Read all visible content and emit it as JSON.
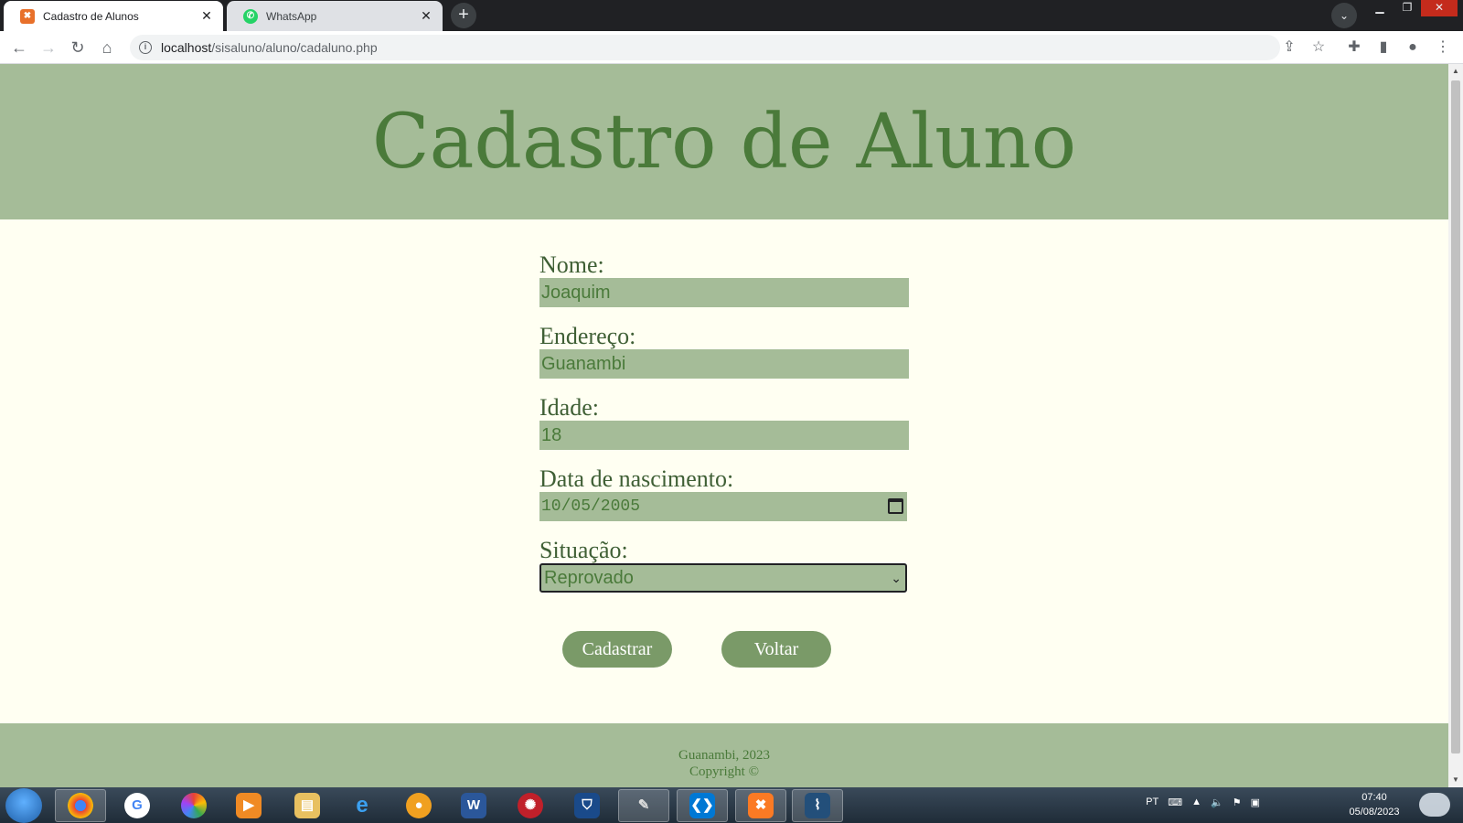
{
  "browser": {
    "tabs": [
      {
        "title": "Cadastro de Alunos",
        "favicon": "xampp-icon",
        "active": true
      },
      {
        "title": "WhatsApp",
        "favicon": "whatsapp-icon",
        "active": false
      }
    ],
    "url_host": "localhost",
    "url_path": "/sisaluno/aluno/cadaluno.php"
  },
  "page": {
    "title": "Cadastro de Aluno",
    "fields": {
      "nome": {
        "label": "Nome:",
        "value": "Joaquim"
      },
      "endereco": {
        "label": "Endereço:",
        "value": "Guanambi"
      },
      "idade": {
        "label": "Idade:",
        "value": "18"
      },
      "data_nascimento": {
        "label": "Data de nascimento:",
        "value": "10/05/2005"
      },
      "situacao": {
        "label": "Situação:",
        "value": "Reprovado"
      }
    },
    "buttons": {
      "submit": "Cadastrar",
      "back": "Voltar"
    },
    "footer": {
      "line1": "Guanambi, 2023",
      "line2": "Copyright ©"
    }
  },
  "taskbar": {
    "language": "PT",
    "time": "07:40",
    "date": "05/08/2023"
  },
  "colors": {
    "banner": "#a5bc98",
    "title_text": "#4a7a3a",
    "page_background": "#fffff2",
    "button": "#7a9a68"
  }
}
